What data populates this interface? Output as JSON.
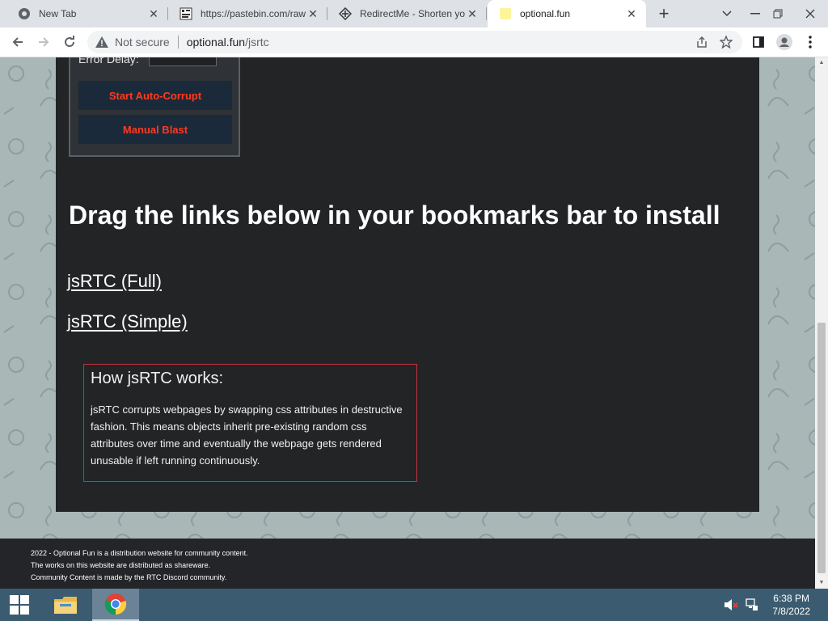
{
  "browser": {
    "tabs": [
      {
        "title": "New Tab",
        "icon": "chrome-icon",
        "active": false
      },
      {
        "title": "https://pastebin.com/raw",
        "icon": "pastebin-icon",
        "active": false
      },
      {
        "title": "RedirectMe - Shorten yo",
        "icon": "redirectme-icon",
        "active": false
      },
      {
        "title": "optional.fun",
        "icon": "yellow-favicon",
        "active": true
      }
    ],
    "new_tab_symbol": "+",
    "address": {
      "security_label": "Not secure",
      "host": "optional.fun",
      "path": "/jsrtc"
    }
  },
  "page": {
    "error_delay_label": "Error Delay:",
    "buttons": {
      "auto_corrupt": "Start Auto-Corrupt",
      "manual_blast": "Manual Blast"
    },
    "heading": "Drag the links below in your bookmarks bar to install",
    "links": {
      "full": "jsRTC (Full)",
      "simple": "jsRTC (Simple)"
    },
    "info": {
      "title": "How jsRTC works:",
      "text": "jsRTC corrupts webpages by swapping css attributes in destructive fashion. This means objects inherit pre-existing random css attributes over time and eventually the webpage gets rendered unusable if left running continuously."
    },
    "footer": {
      "line1": "2022 - Optional Fun is a distribution website for community content.",
      "line2": "The works on this website are distributed as shareware.",
      "line3": "Community Content is made by the RTC Discord community."
    },
    "colors": {
      "card_bg": "#222426",
      "button_text": "#ff3a1f",
      "info_border": "#c4323f"
    }
  },
  "taskbar": {
    "time": "6:38 PM",
    "date": "7/8/2022"
  }
}
